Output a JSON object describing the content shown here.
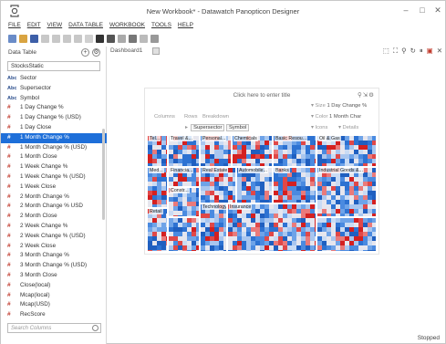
{
  "window": {
    "title": "New Workbook* - Datawatch Panopticon Designer"
  },
  "menu": [
    "FILE",
    "EDIT",
    "VIEW",
    "DATA TABLE",
    "WORKBOOK",
    "TOOLS",
    "HELP"
  ],
  "left_panel": {
    "header": "Data Table",
    "table_select": "StocksStatic",
    "fields": [
      {
        "type": "text",
        "name": "Sector"
      },
      {
        "type": "text",
        "name": "Supersector"
      },
      {
        "type": "text",
        "name": "Symbol"
      },
      {
        "type": "num",
        "name": "1 Day Change %"
      },
      {
        "type": "num",
        "name": "1 Day Change % (USD)"
      },
      {
        "type": "num",
        "name": "1 Day Close"
      },
      {
        "type": "num",
        "name": "1 Month Change %",
        "selected": true
      },
      {
        "type": "num",
        "name": "1 Month Change % (USD)"
      },
      {
        "type": "num",
        "name": "1 Month Close"
      },
      {
        "type": "num",
        "name": "1 Week Change %"
      },
      {
        "type": "num",
        "name": "1 Week Change % (USD)"
      },
      {
        "type": "num",
        "name": "1 Week Close"
      },
      {
        "type": "num",
        "name": "2 Month Change %"
      },
      {
        "type": "num",
        "name": "2 Month Change % USD"
      },
      {
        "type": "num",
        "name": "2 Month Close"
      },
      {
        "type": "num",
        "name": "2 Week Change %"
      },
      {
        "type": "num",
        "name": "2 Week Change % (USD)"
      },
      {
        "type": "num",
        "name": "2 Week Close"
      },
      {
        "type": "num",
        "name": "3 Month Change %"
      },
      {
        "type": "num",
        "name": "3 Month Change % (USD)"
      },
      {
        "type": "num",
        "name": "3 Month Close"
      },
      {
        "type": "num",
        "name": "Close(local)"
      },
      {
        "type": "num",
        "name": "Mcap(local)"
      },
      {
        "type": "num",
        "name": "Mcap(USD)"
      },
      {
        "type": "num",
        "name": "RecScore"
      }
    ],
    "search_placeholder": "Search Columns"
  },
  "dashboard": {
    "tab": "Dashboard1",
    "viz_title": "Click here to enter title",
    "shelves": {
      "columns": "Columns",
      "rows": "Rows",
      "breakdown": "Breakdown",
      "breakdown_items": [
        "Supersector",
        "Symbol"
      ],
      "size_label": "Size",
      "size_value": "1 Day Change %",
      "color_label": "Color",
      "color_value": "1 Month Char",
      "icons_label": "Icons",
      "details_label": "Details"
    },
    "treemap_groups": [
      "Tel...",
      "Travel &...",
      "Personal...",
      "Chemicals",
      "Basic Resou...",
      "Oil & Gas",
      "Med...",
      "Financia...",
      "Constr...",
      "Retail",
      "Real Estate",
      "Automobile...",
      "Banks",
      "Industrial Goods &...",
      "Technology",
      "Insurance"
    ],
    "colors": {
      "positive": "#1f5fc0",
      "negative": "#d42020",
      "neutral": "#e6e6ee"
    }
  },
  "status": "Stopped"
}
